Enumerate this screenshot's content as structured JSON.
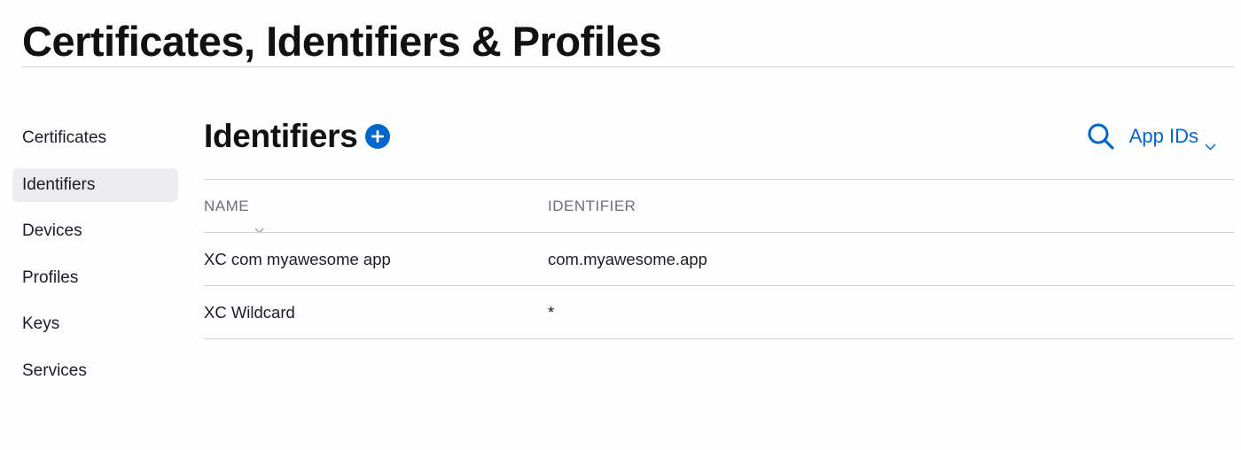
{
  "page": {
    "title": "Certificates, Identifiers & Profiles"
  },
  "sidebar": {
    "items": [
      {
        "label": "Certificates",
        "active": false
      },
      {
        "label": "Identifiers",
        "active": true
      },
      {
        "label": "Devices",
        "active": false
      },
      {
        "label": "Profiles",
        "active": false
      },
      {
        "label": "Keys",
        "active": false
      },
      {
        "label": "Services",
        "active": false
      }
    ]
  },
  "section": {
    "title": "Identifiers",
    "add_icon": "plus-circle-icon"
  },
  "tools": {
    "search_icon": "magnifier-icon",
    "filter_label": "App IDs",
    "filter_icon": "chevron-down-icon"
  },
  "table": {
    "columns": [
      {
        "label": "NAME",
        "sort_icon": "chevron-down-icon"
      },
      {
        "label": "IDENTIFIER"
      }
    ],
    "rows": [
      {
        "name": "XC com myawesome app",
        "identifier": "com.myawesome.app"
      },
      {
        "name": "XC Wildcard",
        "identifier": "*"
      }
    ]
  },
  "colors": {
    "accent": "#0066cc",
    "active_bg": "#ececef",
    "divider": "#d2d2d7",
    "muted_text": "#6e6e73"
  }
}
